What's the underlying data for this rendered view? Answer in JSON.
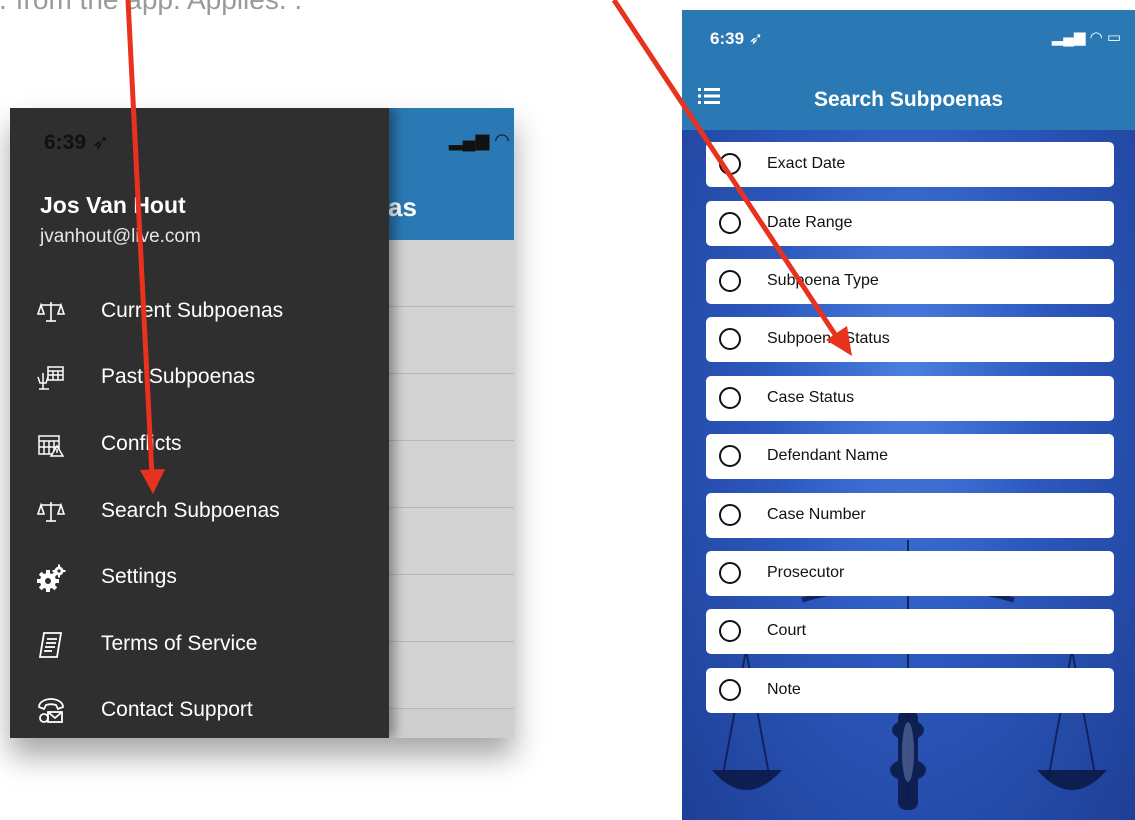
{
  "caption": "… from the app. Applies. .",
  "left_phone": {
    "background": {
      "title_fragment": "as",
      "status_icons": "▂▄▆ ◠",
      "row_count": 7
    },
    "drawer": {
      "time": "6:39 ➶",
      "user": {
        "name": "Jos Van Hout",
        "email": "jvanhout@live.com"
      },
      "items": [
        {
          "label": "Current Subpoenas",
          "icon": "scales-icon"
        },
        {
          "label": "Past Subpoenas",
          "icon": "calendar-scales-icon"
        },
        {
          "label": "Conflicts",
          "icon": "calendar-warning-icon"
        },
        {
          "label": "Search Subpoenas",
          "icon": "scales-icon"
        },
        {
          "label": "Settings",
          "icon": "gears-icon"
        },
        {
          "label": "Terms of Service",
          "icon": "document-icon"
        },
        {
          "label": "Contact Support",
          "icon": "phone-mail-icon"
        }
      ]
    }
  },
  "right_phone": {
    "status": {
      "time": "6:39 ➶",
      "icons": "▂▄▆ ◠ ▭"
    },
    "title": "Search Subpoenas",
    "options": [
      "Exact Date",
      "Date Range",
      "Subpoena Type",
      "Subpoena Status",
      "Case Status",
      "Defendant Name",
      "Case Number",
      "Prosecutor",
      "Court",
      "Note"
    ]
  },
  "colors": {
    "header_blue": "#2b79b4",
    "drawer_bg": "#2f2f2f",
    "arrow_red": "#e8321e",
    "search_bg": "#2c58bd"
  }
}
